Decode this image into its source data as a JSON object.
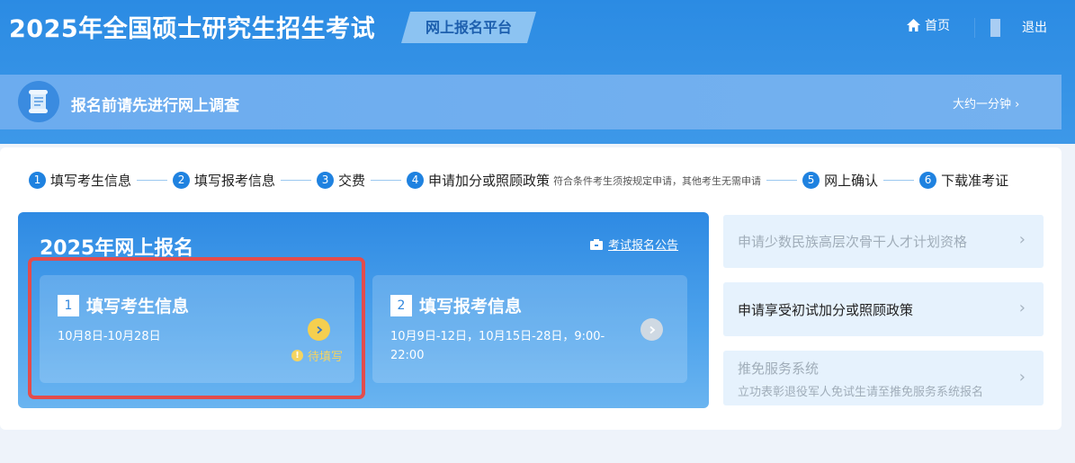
{
  "header": {
    "site_title": "2025年全国硕士研究生招生考试",
    "platform_tag": "网上报名平台",
    "nav_home": "首页",
    "nav_logout": "退出"
  },
  "survey": {
    "text": "报名前请先进行网上调查",
    "time": "大约一分钟 ›"
  },
  "steps": [
    {
      "num": "1",
      "label": "填写考生信息"
    },
    {
      "num": "2",
      "label": "填写报考信息"
    },
    {
      "num": "3",
      "label": "交费"
    },
    {
      "num": "4",
      "label": "申请加分或照顾政策",
      "note": "符合条件考生须按规定申请，其他考生无需申请"
    },
    {
      "num": "5",
      "label": "网上确认"
    },
    {
      "num": "6",
      "label": "下载准考证"
    }
  ],
  "registration": {
    "title": "2025年网上报名",
    "notice_link": "考试报名公告",
    "cards": [
      {
        "num": "1",
        "title": "填写考生信息",
        "dates": "10月8日-10月28日",
        "status": "待填写"
      },
      {
        "num": "2",
        "title": "填写报考信息",
        "dates": "10月9日-12日，10月15日-28日，9:00-22:00"
      }
    ]
  },
  "side_items": [
    {
      "label": "申请少数民族高层次骨干人才计划资格",
      "state": "disabled"
    },
    {
      "label": "申请享受初试加分或照顾政策",
      "state": "active"
    },
    {
      "label": "推免服务系统",
      "sub": "立功表彰退役军人免试生请至推免服务系统报名",
      "state": "disabled"
    }
  ],
  "colors": {
    "primary": "#1f82e0",
    "highlight": "#e34c4c",
    "pending": "#f5cf4f"
  }
}
